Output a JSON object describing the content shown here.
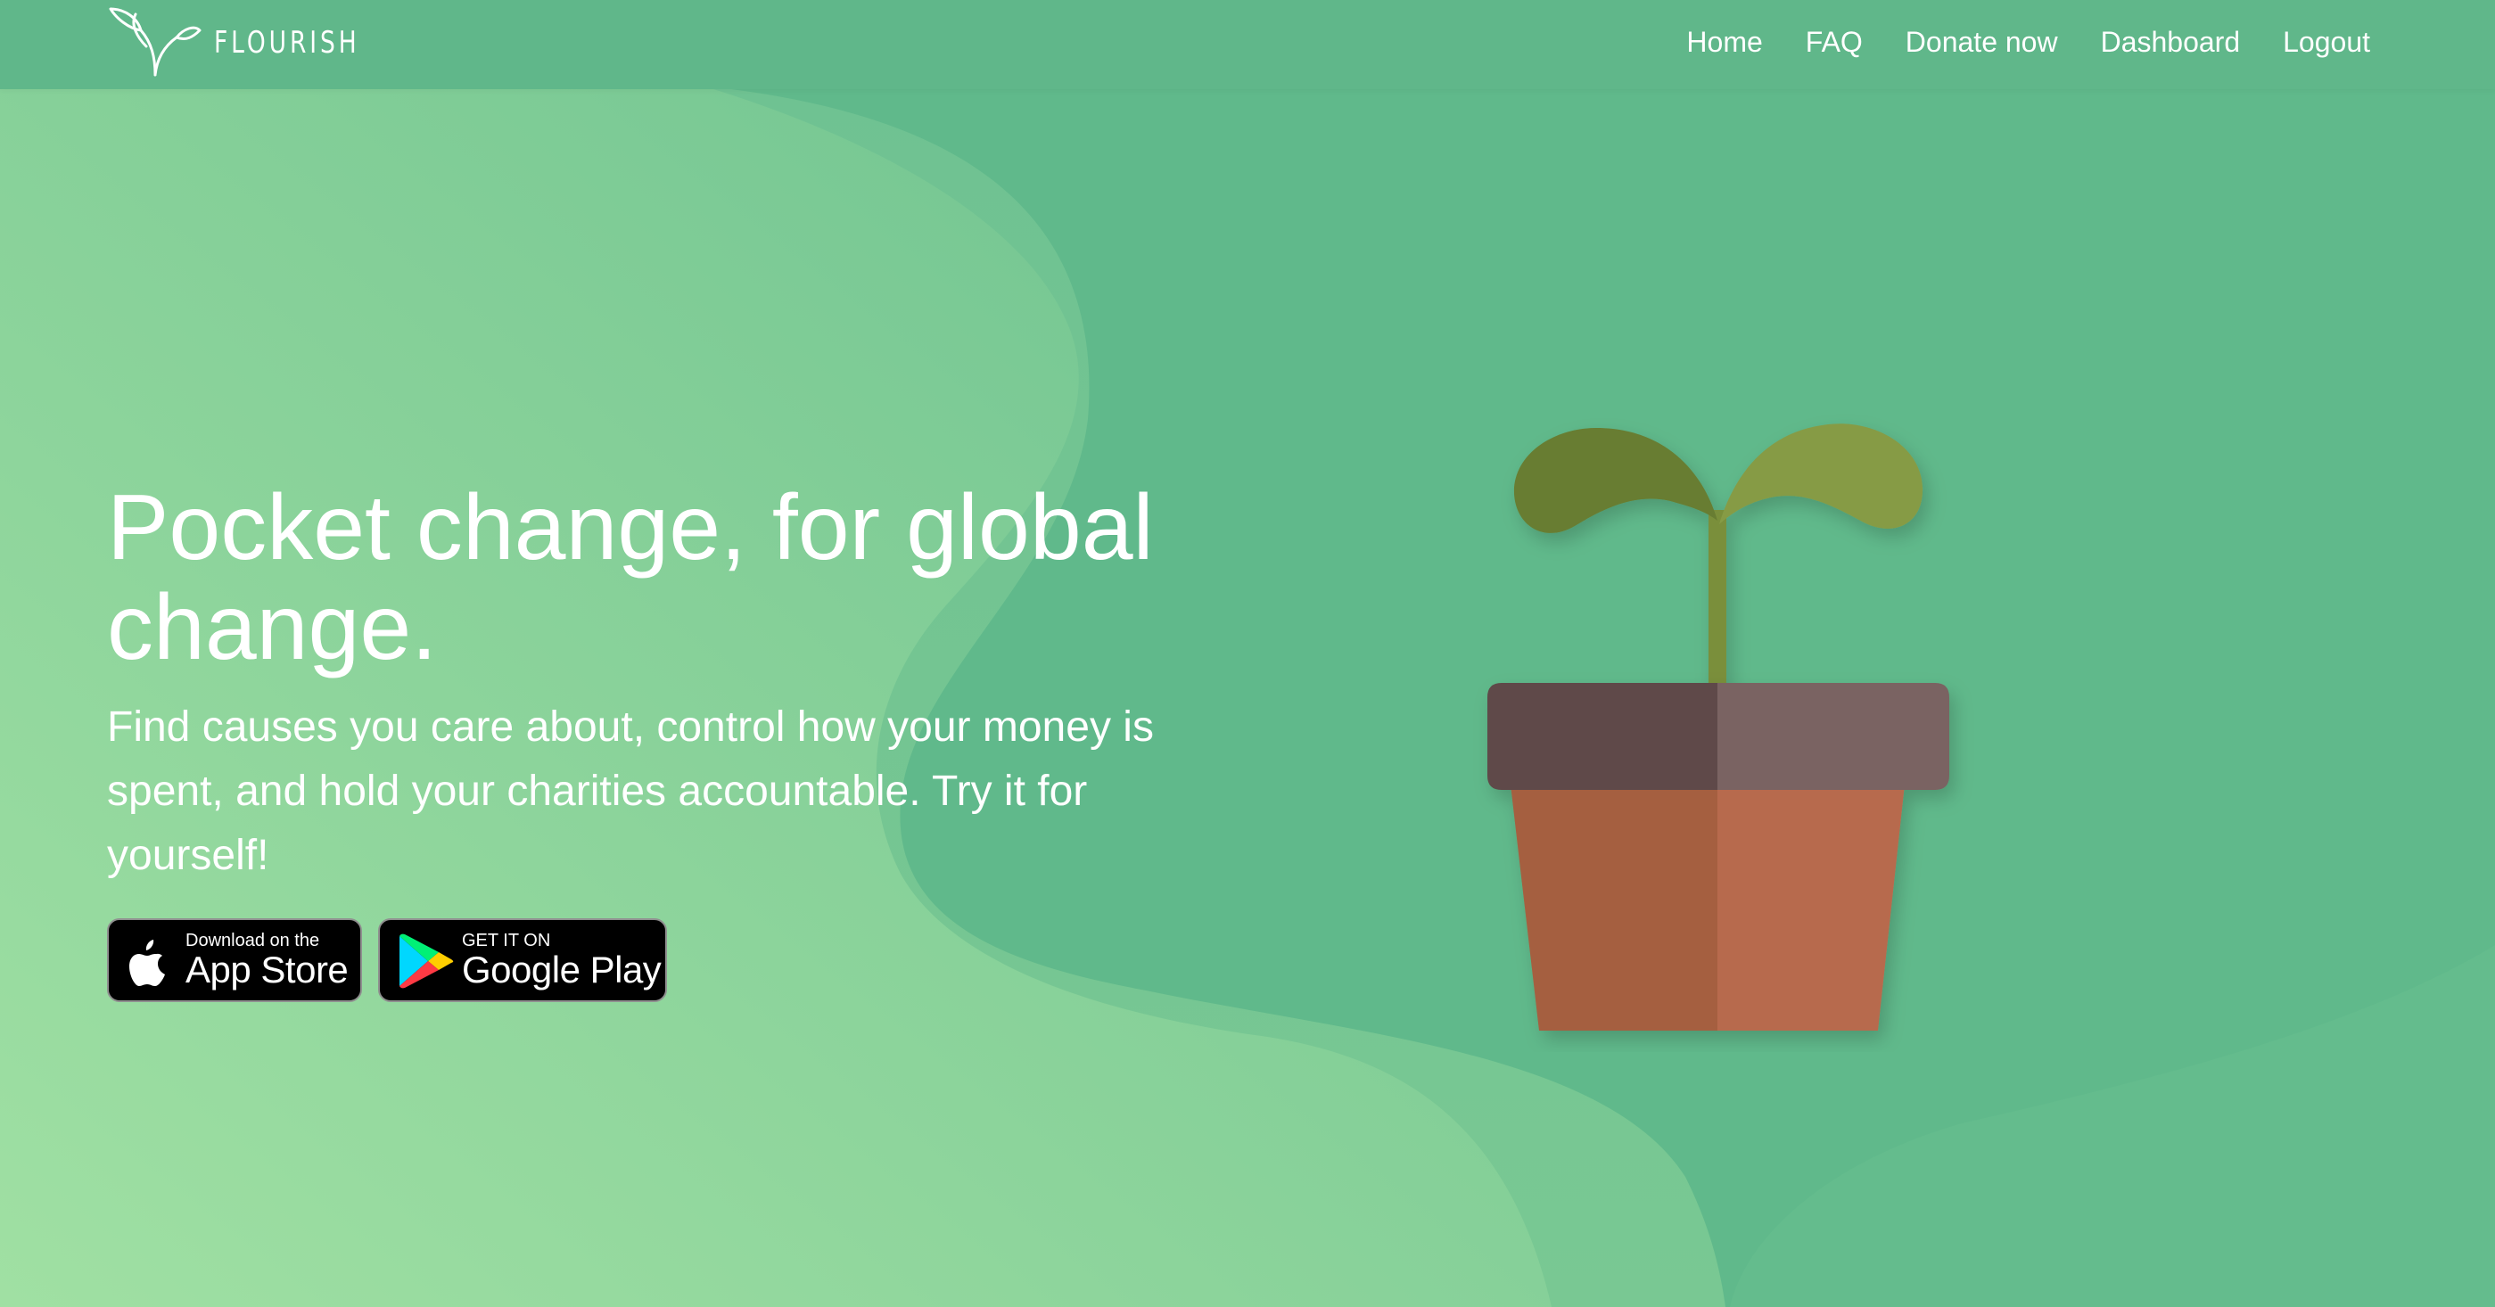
{
  "brand": {
    "name": "FLOURISH"
  },
  "nav": {
    "items": [
      {
        "label": "Home"
      },
      {
        "label": "FAQ"
      },
      {
        "label": "Donate now"
      },
      {
        "label": "Dashboard"
      },
      {
        "label": "Logout"
      }
    ]
  },
  "hero": {
    "title": "Pocket change, for global change.",
    "subtitle": "Find causes you care about, control how your money is spent, and hold your charities accountable. Try it for yourself!"
  },
  "badges": {
    "app_store": {
      "small": "Download on the",
      "big": "App Store",
      "icon": "apple-icon"
    },
    "google_play": {
      "small": "GET IT ON",
      "big": "Google Play",
      "icon": "google-play-icon"
    }
  },
  "illustration": {
    "name": "potted-seedling",
    "colors": {
      "leaf_left": "#677d31",
      "leaf_right": "#869b45",
      "stem": "#7a8f3b",
      "pot_rim_left": "#5e4a48",
      "pot_rim_right": "#7a6462",
      "pot_body_left": "#a55f3f",
      "pot_body_right": "#b76a4d"
    }
  },
  "theme": {
    "background": "#60b98b",
    "accent_light": "#9bdca0",
    "text": "#ffffff"
  }
}
